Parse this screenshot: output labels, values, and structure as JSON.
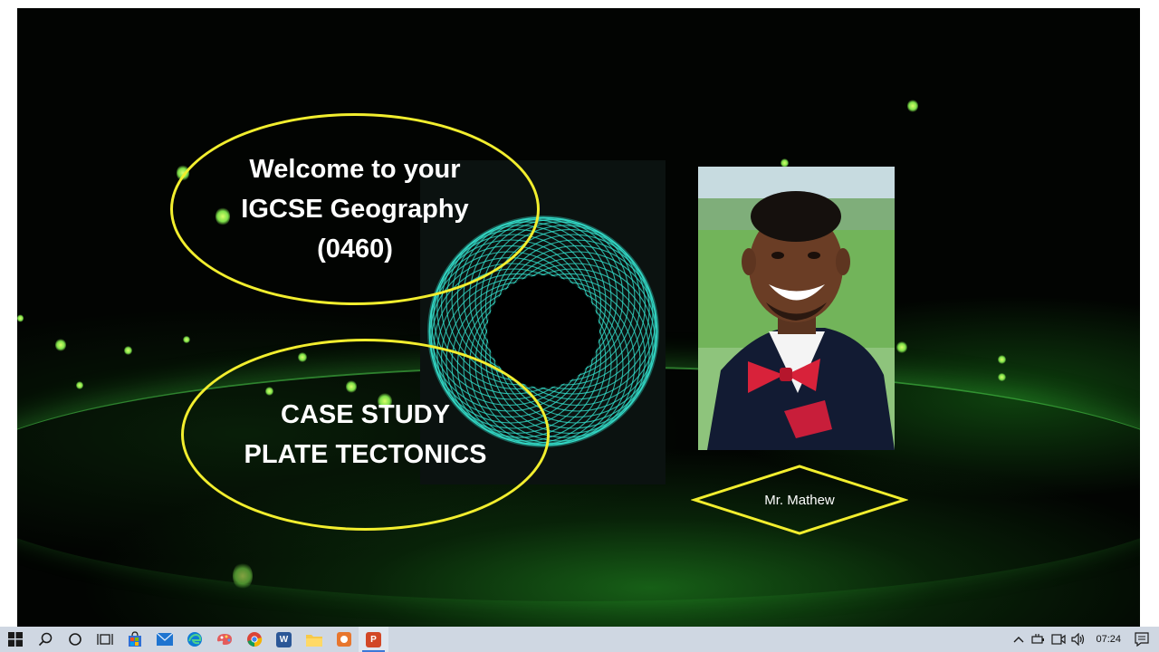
{
  "slide": {
    "welcome_lines": [
      "Welcome to your",
      "IGCSE Geography",
      "(0460)"
    ],
    "case_lines": [
      "CASE STUDY",
      "PLATE TECTONICS"
    ],
    "presenter_name": "Mr. Mathew",
    "accent_color": "#f2ee2e",
    "ring_color": "#35e5d2"
  },
  "taskbar": {
    "clock": "07:24",
    "apps": [
      "windows-start",
      "search",
      "cortana",
      "task-view",
      "microsoft-store",
      "mail",
      "edge",
      "paint-3d",
      "chrome",
      "word",
      "file-explorer",
      "app-orange",
      "powerpoint"
    ],
    "active_app": "powerpoint"
  }
}
